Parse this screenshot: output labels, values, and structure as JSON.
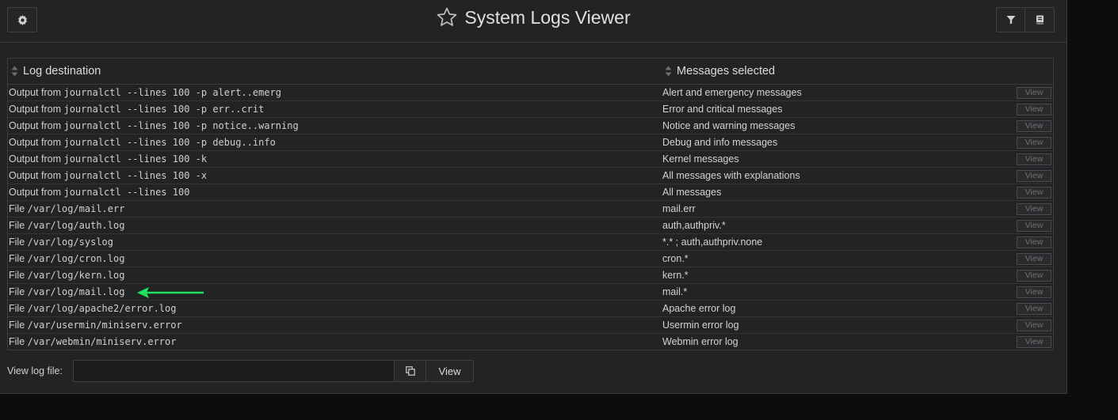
{
  "header": {
    "title": "System Logs Viewer"
  },
  "table": {
    "columns": [
      "Log destination",
      "Messages selected"
    ],
    "view_label": "View",
    "rows": [
      {
        "prefix": "Output from",
        "path": "journalctl --lines 100 -p alert..emerg",
        "messages": "Alert and emergency messages"
      },
      {
        "prefix": "Output from",
        "path": "journalctl --lines 100 -p err..crit",
        "messages": "Error and critical messages"
      },
      {
        "prefix": "Output from",
        "path": "journalctl --lines 100 -p notice..warning",
        "messages": "Notice and warning messages"
      },
      {
        "prefix": "Output from",
        "path": "journalctl --lines 100 -p debug..info",
        "messages": "Debug and info messages"
      },
      {
        "prefix": "Output from",
        "path": "journalctl --lines 100 -k",
        "messages": "Kernel messages"
      },
      {
        "prefix": "Output from",
        "path": "journalctl --lines 100 -x",
        "messages": "All messages with explanations"
      },
      {
        "prefix": "Output from",
        "path": "journalctl --lines 100",
        "messages": "All messages"
      },
      {
        "prefix": "File",
        "path": "/var/log/mail.err",
        "messages": "mail.err"
      },
      {
        "prefix": "File",
        "path": "/var/log/auth.log",
        "messages": "auth,authpriv.*"
      },
      {
        "prefix": "File",
        "path": "/var/log/syslog",
        "messages": "*.* ; auth,authpriv.none"
      },
      {
        "prefix": "File",
        "path": "/var/log/cron.log",
        "messages": "cron.*"
      },
      {
        "prefix": "File",
        "path": "/var/log/kern.log",
        "messages": "kern.*"
      },
      {
        "prefix": "File",
        "path": "/var/log/mail.log",
        "messages": "mail.*"
      },
      {
        "prefix": "File",
        "path": "/var/log/apache2/error.log",
        "messages": "Apache error log"
      },
      {
        "prefix": "File",
        "path": "/var/usermin/miniserv.error",
        "messages": "Usermin error log"
      },
      {
        "prefix": "File",
        "path": "/var/webmin/miniserv.error",
        "messages": "Webmin error log"
      }
    ]
  },
  "footer": {
    "label": "View log file:",
    "input_value": "",
    "view_button": "View"
  },
  "icons": {
    "settings": "gear-icon",
    "title": "star-icon",
    "filter": "filter-icon",
    "book": "book-icon",
    "copy": "copy-icon",
    "annotation": "arrow-icon"
  },
  "colors": {
    "annotation_arrow": "#1ee35e",
    "panel_bg": "#222325",
    "page_bg": "#0d0d0d"
  }
}
